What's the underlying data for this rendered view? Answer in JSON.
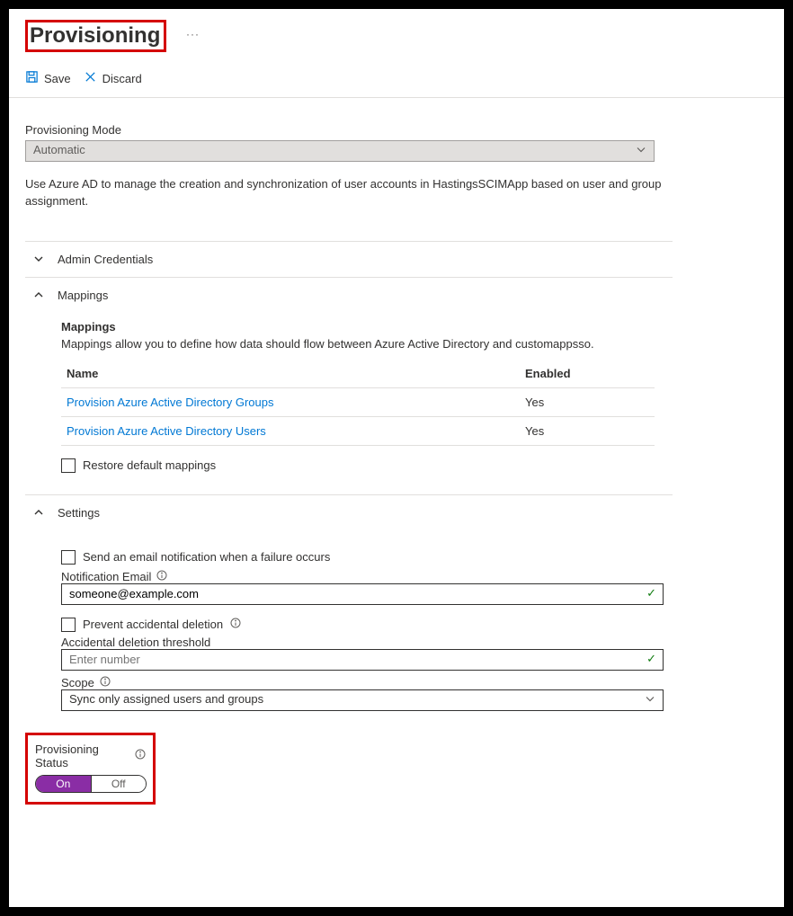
{
  "header": {
    "title": "Provisioning"
  },
  "toolbar": {
    "save_label": "Save",
    "discard_label": "Discard"
  },
  "mode": {
    "label": "Provisioning Mode",
    "value": "Automatic"
  },
  "description": "Use Azure AD to manage the creation and synchronization of user accounts in HastingsSCIMApp based on user and group assignment.",
  "sections": {
    "admin": {
      "title": "Admin Credentials"
    },
    "mappings": {
      "title": "Mappings",
      "sub_heading": "Mappings",
      "sub_desc": "Mappings allow you to define how data should flow between Azure Active Directory and customappsso.",
      "col_name": "Name",
      "col_enabled": "Enabled",
      "rows": [
        {
          "name": "Provision Azure Active Directory Groups",
          "enabled": "Yes"
        },
        {
          "name": "Provision Azure Active Directory Users",
          "enabled": "Yes"
        }
      ],
      "restore_label": "Restore default mappings"
    },
    "settings": {
      "title": "Settings",
      "failure_email_label": "Send an email notification when a failure occurs",
      "notification_email_label": "Notification Email",
      "notification_email_value": "someone@example.com",
      "prevent_deletion_label": "Prevent accidental deletion",
      "deletion_threshold_label": "Accidental deletion threshold",
      "deletion_threshold_placeholder": "Enter number",
      "scope_label": "Scope",
      "scope_value": "Sync only assigned users and groups",
      "status_label": "Provisioning Status",
      "toggle_on": "On",
      "toggle_off": "Off"
    }
  }
}
